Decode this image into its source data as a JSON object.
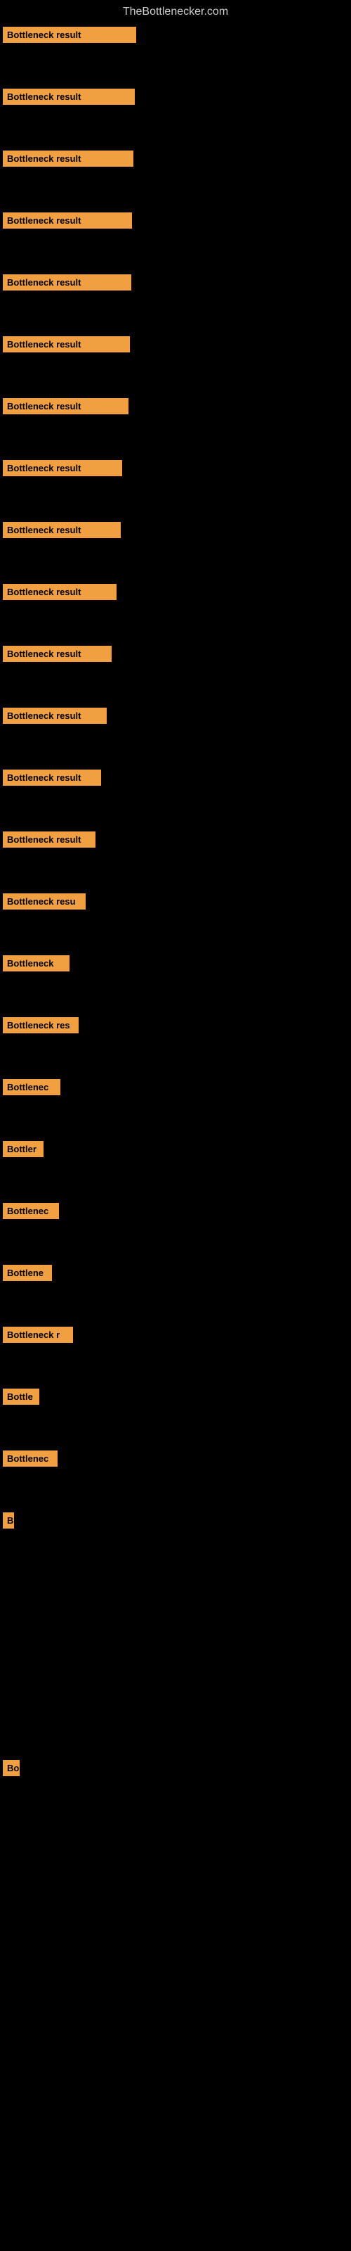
{
  "site": {
    "title": "TheBottlenecker.com"
  },
  "bars": [
    {
      "id": 1,
      "label": "Bottleneck result",
      "width": 190
    },
    {
      "id": 2,
      "label": "Bottleneck result",
      "width": 188
    },
    {
      "id": 3,
      "label": "Bottleneck result",
      "width": 186
    },
    {
      "id": 4,
      "label": "Bottleneck result",
      "width": 184
    },
    {
      "id": 5,
      "label": "Bottleneck result",
      "width": 183
    },
    {
      "id": 6,
      "label": "Bottleneck result",
      "width": 181
    },
    {
      "id": 7,
      "label": "Bottleneck result",
      "width": 179
    },
    {
      "id": 8,
      "label": "Bottleneck result",
      "width": 170
    },
    {
      "id": 9,
      "label": "Bottleneck result",
      "width": 168
    },
    {
      "id": 10,
      "label": "Bottleneck result",
      "width": 162
    },
    {
      "id": 11,
      "label": "Bottleneck result",
      "width": 155
    },
    {
      "id": 12,
      "label": "Bottleneck result",
      "width": 148
    },
    {
      "id": 13,
      "label": "Bottleneck result",
      "width": 140
    },
    {
      "id": 14,
      "label": "Bottleneck result",
      "width": 132
    },
    {
      "id": 15,
      "label": "Bottleneck resu",
      "width": 118
    },
    {
      "id": 16,
      "label": "Bottleneck",
      "width": 95
    },
    {
      "id": 17,
      "label": "Bottleneck res",
      "width": 108
    },
    {
      "id": 18,
      "label": "Bottlenec",
      "width": 82
    },
    {
      "id": 19,
      "label": "Bottler",
      "width": 58
    },
    {
      "id": 20,
      "label": "Bottlenec",
      "width": 80
    },
    {
      "id": 21,
      "label": "Bottlene",
      "width": 70
    },
    {
      "id": 22,
      "label": "Bottleneck r",
      "width": 100
    },
    {
      "id": 23,
      "label": "Bottle",
      "width": 52
    },
    {
      "id": 24,
      "label": "Bottlenec",
      "width": 78
    },
    {
      "id": 25,
      "label": "B",
      "width": 16
    },
    {
      "id": 26,
      "label": "",
      "width": 0
    },
    {
      "id": 27,
      "label": "",
      "width": 0
    },
    {
      "id": 28,
      "label": "",
      "width": 0
    },
    {
      "id": 29,
      "label": "Bo",
      "width": 24
    },
    {
      "id": 30,
      "label": "",
      "width": 0
    },
    {
      "id": 31,
      "label": "",
      "width": 0
    },
    {
      "id": 32,
      "label": "",
      "width": 0
    },
    {
      "id": 33,
      "label": "",
      "width": 0
    }
  ],
  "colors": {
    "background": "#000000",
    "bar": "#f0a040",
    "title": "#cccccc"
  }
}
